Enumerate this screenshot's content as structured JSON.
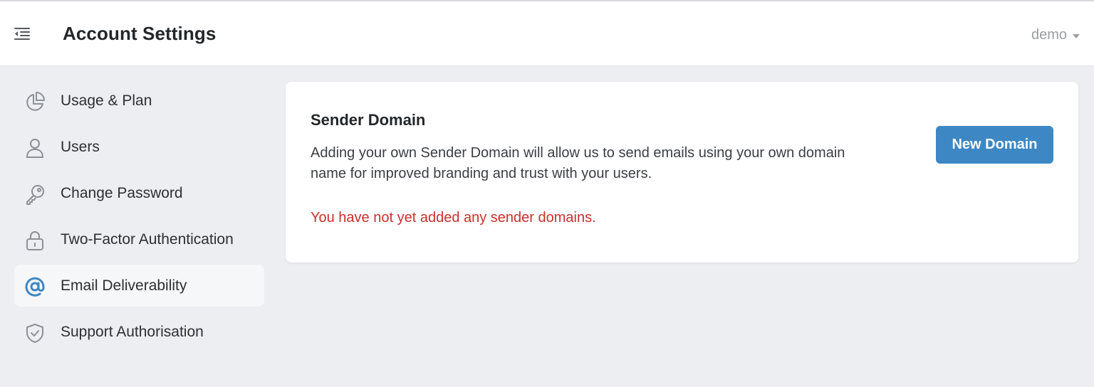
{
  "header": {
    "title": "Account Settings",
    "menu_icon": "menu-collapse-icon",
    "user_name": "demo"
  },
  "sidebar": {
    "items": [
      {
        "label": "Usage & Plan",
        "icon": "pie-chart-icon",
        "active": false
      },
      {
        "label": "Users",
        "icon": "user-icon",
        "active": false
      },
      {
        "label": "Change Password",
        "icon": "key-icon",
        "active": false
      },
      {
        "label": "Two-Factor Authentication",
        "icon": "lock-icon",
        "active": false
      },
      {
        "label": "Email Deliverability",
        "icon": "at-sign-icon",
        "active": true
      },
      {
        "label": "Support Authorisation",
        "icon": "shield-check-icon",
        "active": false
      }
    ]
  },
  "main": {
    "card": {
      "title": "Sender Domain",
      "description": "Adding your own Sender Domain will allow us to send emails using your own domain name for improved branding and trust with your users.",
      "empty_message": "You have not yet added any sender domains.",
      "button_label": "New Domain"
    }
  },
  "colors": {
    "accent": "#3d87c4",
    "error": "#c9302c",
    "background": "#eceef1",
    "icon_gray": "#8c9096"
  }
}
